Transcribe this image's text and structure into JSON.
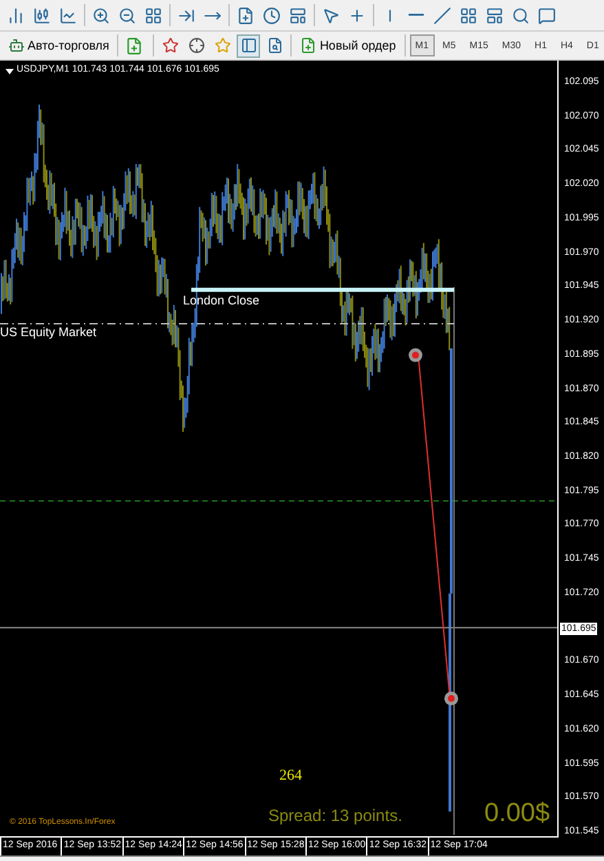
{
  "toolbar_2": {
    "auto_trading": "Авто-торговля",
    "new_order": "Новый ордер",
    "timeframes": [
      {
        "label": "M1",
        "selected": true
      },
      {
        "label": "M5",
        "selected": false
      },
      {
        "label": "M15",
        "selected": false
      },
      {
        "label": "M30",
        "selected": false
      },
      {
        "label": "H1",
        "selected": false
      },
      {
        "label": "H4",
        "selected": false
      },
      {
        "label": "D1",
        "selected": false
      }
    ]
  },
  "chart": {
    "header": "USDJPY,M1  101.743 101.744 101.676 101.695",
    "lines": [
      {
        "kind": "level",
        "label": "London Close"
      },
      {
        "kind": "dashdot",
        "label": "US Equity Market"
      }
    ],
    "counter": "264",
    "spread": "Spread: 13 points.",
    "profit": "0.00$",
    "copyright": "© 2016 TopLessons.In/Forex"
  },
  "price_axis": {
    "labels": [
      "102.095",
      "102.070",
      "102.045",
      "102.020",
      "101.995",
      "101.970",
      "101.945",
      "101.920",
      "101.895",
      "101.870",
      "101.845",
      "101.820",
      "101.795",
      "101.770",
      "101.745",
      "101.720",
      "101.670",
      "101.645",
      "101.620",
      "101.595",
      "101.570",
      "101.545"
    ],
    "current_price": "101.695"
  },
  "time_axis": {
    "labels": [
      "12 Sep 2016",
      "12 Sep 13:52",
      "12 Sep 14:24",
      "12 Sep 14:56",
      "12 Sep 15:28",
      "12 Sep 16:00",
      "12 Sep 16:32",
      "12 Sep 17:04"
    ]
  }
}
